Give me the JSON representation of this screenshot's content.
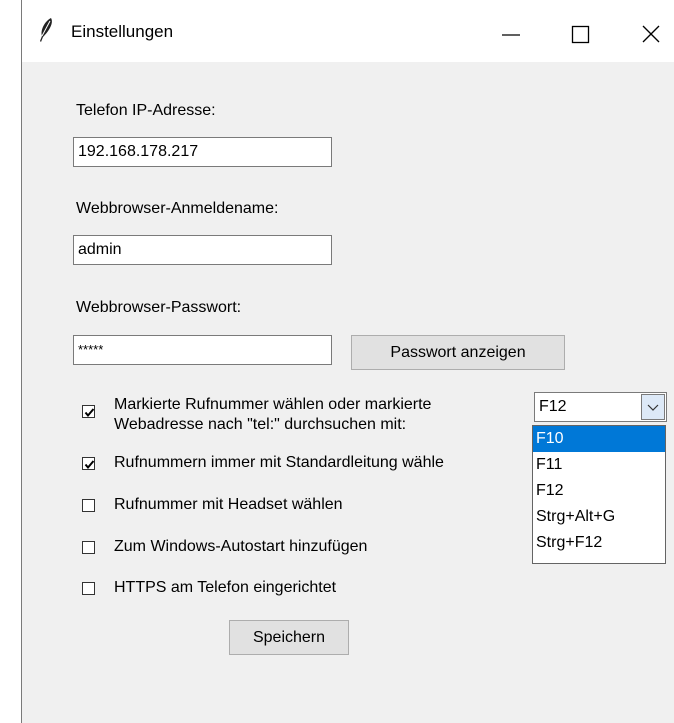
{
  "window": {
    "title": "Einstellungen",
    "icon": "feather-icon",
    "controls": {
      "minimize": "minimize-icon",
      "maximize": "maximize-icon",
      "close": "close-icon"
    }
  },
  "form": {
    "ip_label": "Telefon IP-Adresse:",
    "ip_value": "192.168.178.217",
    "user_label": "Webbrowser-Anmeldename:",
    "user_value": "admin",
    "password_label": "Webbrowser-Passwort:",
    "password_value": "*****",
    "show_password_button": "Passwort anzeigen",
    "checks": [
      {
        "label_line1": "Markierte Rufnummer wählen oder markierte",
        "label_line2": "Webadresse nach \"tel:\" durchsuchen mit:",
        "checked": true
      },
      {
        "label": "Rufnummern immer mit Standardleitung wähle",
        "checked": true
      },
      {
        "label": "Rufnummer mit Headset wählen",
        "checked": false
      },
      {
        "label": "Zum Windows-Autostart hinzufügen",
        "checked": false
      },
      {
        "label": "HTTPS am Telefon eingerichtet",
        "checked": false
      }
    ],
    "save_button": "Speichern"
  },
  "hotkey_combo": {
    "selected": "F12",
    "options": [
      "F10",
      "F11",
      "F12",
      "Strg+Alt+G",
      "Strg+F12"
    ],
    "highlighted": "F10"
  },
  "colors": {
    "window_bg": "#f0f0f0",
    "highlight": "#0078d7",
    "accent_corner": "#1e9b3c"
  }
}
